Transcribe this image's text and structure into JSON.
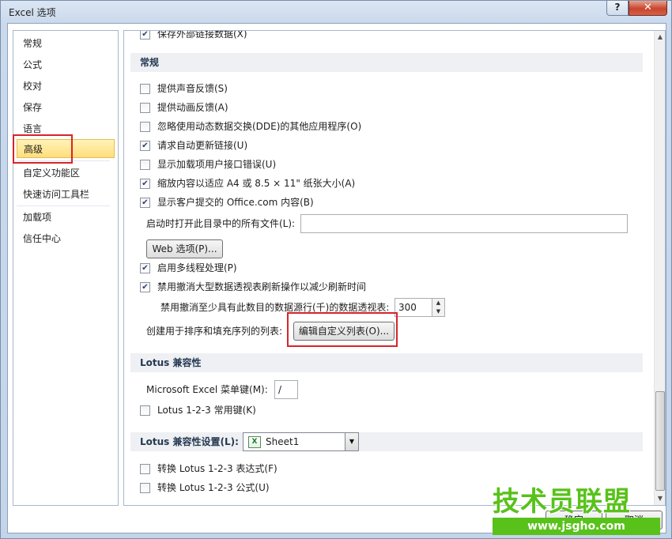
{
  "window": {
    "title": "Excel 选项",
    "help": "?",
    "close": "✕"
  },
  "nav": {
    "items": [
      "常规",
      "公式",
      "校对",
      "保存",
      "语言",
      "高级",
      "自定义功能区",
      "快速访问工具栏",
      "加载项",
      "信任中心"
    ],
    "active_index": 5
  },
  "main": {
    "top_partial": "保存外部链接数据(X)",
    "general_section": "常规",
    "options": [
      {
        "label": "提供声音反馈(S)",
        "checked": false
      },
      {
        "label": "提供动画反馈(A)",
        "checked": false
      },
      {
        "label": "忽略使用动态数据交换(DDE)的其他应用程序(O)",
        "checked": false
      },
      {
        "label": "请求自动更新链接(U)",
        "checked": true
      },
      {
        "label": "显示加载项用户接口错误(U)",
        "checked": false
      },
      {
        "label": "缩放内容以适应 A4 或 8.5 × 11\" 纸张大小(A)",
        "checked": true
      },
      {
        "label": "显示客户提交的 Office.com 内容(B)",
        "checked": true
      }
    ],
    "startup_label": "启动时打开此目录中的所有文件(L):",
    "startup_value": "",
    "web_options_button": "Web 选项(P)...",
    "multithread": {
      "label": "启用多线程处理(P)",
      "checked": true
    },
    "disable_undo": {
      "label": "禁用撤消大型数据透视表刷新操作以减少刷新时间",
      "checked": true
    },
    "undo_rows_label": "禁用撤消至少具有此数目的数据源行(千)的数据透视表:",
    "undo_rows_value": "300",
    "custom_list_label": "创建用于排序和填充序列的列表:",
    "custom_list_button": "编辑自定义列表(O)...",
    "lotus_section": "Lotus 兼容性",
    "menu_key_label": "Microsoft Excel 菜单键(M):",
    "menu_key_value": "/",
    "lotus_nav_keys": {
      "label": "Lotus 1-2-3 常用键(K)",
      "checked": false
    },
    "lotus_settings_label": "Lotus 兼容性设置(L):",
    "lotus_sheet": "Sheet1",
    "lotus_formula_eval": {
      "label": "转换 Lotus 1-2-3 表达式(F)",
      "checked": false
    },
    "lotus_formula_entry": {
      "label": "转换 Lotus 1-2-3 公式(U)",
      "checked": false
    }
  },
  "footer": {
    "ok": "确定",
    "cancel": "取消"
  },
  "watermark": {
    "big": "技术员联盟",
    "small": "www.jsgho.com"
  }
}
